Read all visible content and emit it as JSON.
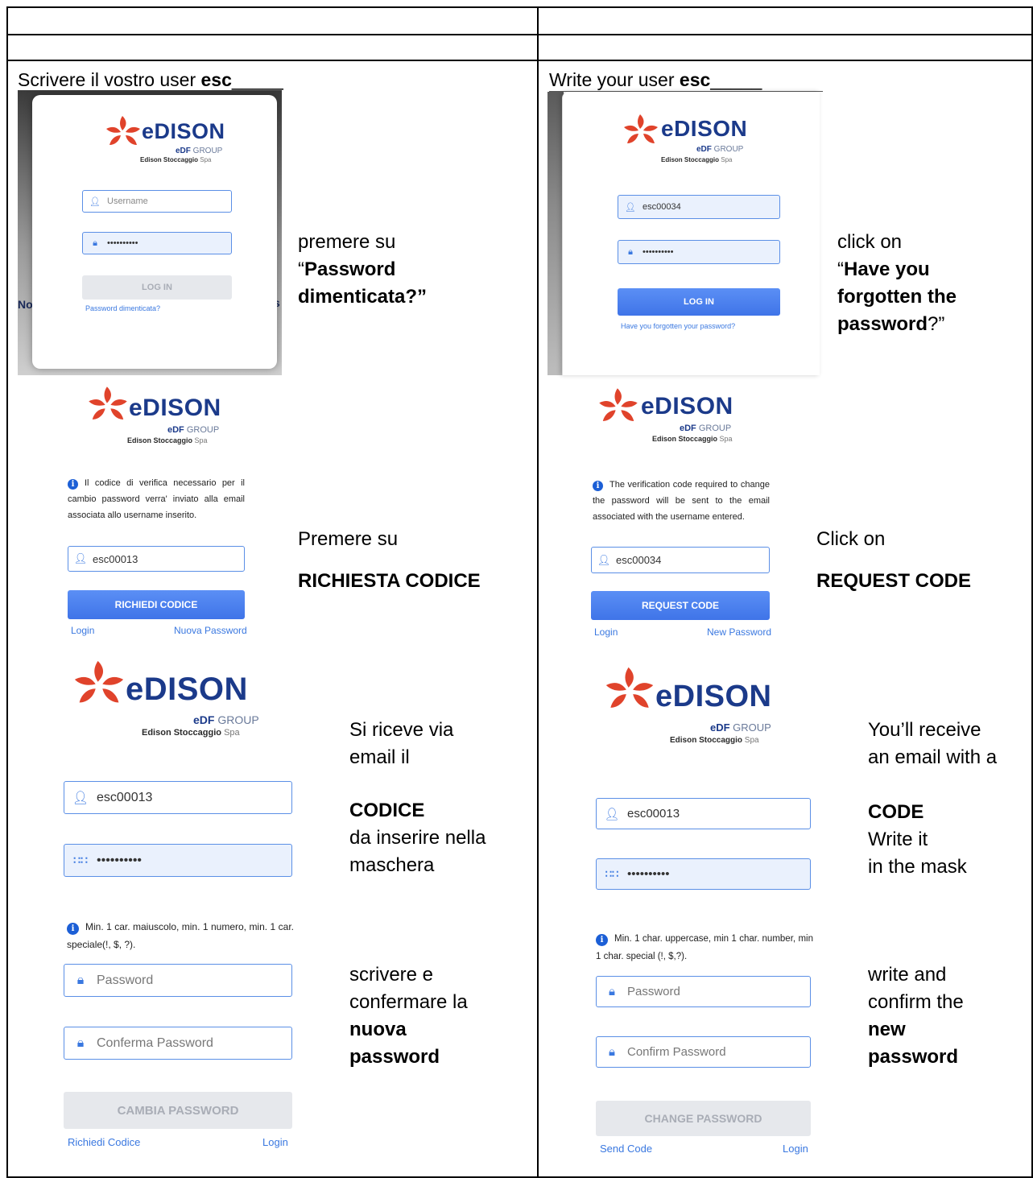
{
  "left": {
    "title_prefix": "Scrivere il vostro user ",
    "title_bold": "esc",
    "title_suffix": "_____",
    "step1": {
      "username_placeholder": "Username",
      "password_value": "••••••••••",
      "login_button": "LOG IN",
      "forgot_link": "Password dimenticata?",
      "bg_fragment": "No",
      "note_line1": "premere su",
      "note_q1": "“",
      "note_bold": "Password dimenticata?”"
    },
    "step2": {
      "info_text": "Il codice di verifica necessario per il cambio password verra' inviato alla email associata allo username inserito.",
      "username_value": "esc00013",
      "request_button": "RICHIEDI CODICE",
      "login_link": "Login",
      "new_password_link": "Nuova Password",
      "note_line1": "Premere su",
      "note_bold": "RICHIESTA CODICE"
    },
    "step3": {
      "username_value": "esc00013",
      "code_value": "••••••••••",
      "info_text": "Min. 1 car. maiuscolo, min. 1 numero, min. 1 car. speciale(!, $, ?).",
      "password_placeholder": "Password",
      "confirm_placeholder": "Conferma Password",
      "change_button": "CAMBIA PASSWORD",
      "request_link": "Richiedi Codice",
      "login_link": "Login",
      "note_a1": "Si riceve via",
      "note_a2": "email il",
      "note_b_bold": "CODICE",
      "note_b2": "da inserire nella",
      "note_b3": "maschera",
      "note_c1": "scrivere e",
      "note_c2": "confermare la",
      "note_c3_bold": "nuova",
      "note_c4_bold": "password"
    }
  },
  "right": {
    "title_prefix": "Write your user ",
    "title_bold": "esc",
    "title_suffix": "_____",
    "step1": {
      "username_value": "esc00034",
      "password_value": "••••••••••",
      "login_button": "LOG IN",
      "forgot_link": "Have you forgotten your password?",
      "note_line1": "click on",
      "note_q1": "“",
      "note_bold1": "Have you",
      "note_bold2": "forgotten the",
      "note_bold3": "password",
      "note_end": "?”"
    },
    "step2": {
      "info_text": "The verification code required to change the password will be sent to the email associated with the username entered.",
      "username_value": "esc00034",
      "request_button": "REQUEST CODE",
      "login_link": "Login",
      "new_password_link": "New Password",
      "note_line1": "Click on",
      "note_bold": "REQUEST CODE"
    },
    "step3": {
      "username_value": "esc00013",
      "code_value": "••••••••••",
      "info_text": "Min. 1 char. uppercase, min 1 char. number, min 1 char. special (!, $,?).",
      "password_placeholder": "Password",
      "confirm_placeholder": "Confirm Password",
      "change_button": "CHANGE PASSWORD",
      "send_link": "Send Code",
      "login_link": "Login",
      "note_a1": "You’ll receive",
      "note_a2": "an email with a",
      "note_b_bold": "CODE",
      "note_b2": "Write it",
      "note_b3": "in the mask",
      "note_c1": "write and",
      "note_c2": "confirm the",
      "note_c3_bold": "new",
      "note_c4_bold": "password"
    }
  },
  "logo": {
    "brand": "eDISON",
    "group_bold": "eDF",
    "group_rest": " GROUP",
    "company_bold": "Edison Stoccaggio",
    "company_rest": " Spa"
  },
  "colors": {
    "brand_blue": "#1b3a8a",
    "logo_red": "#e0432b",
    "button_blue": "#4a80ee",
    "link_blue": "#3a78e0"
  }
}
